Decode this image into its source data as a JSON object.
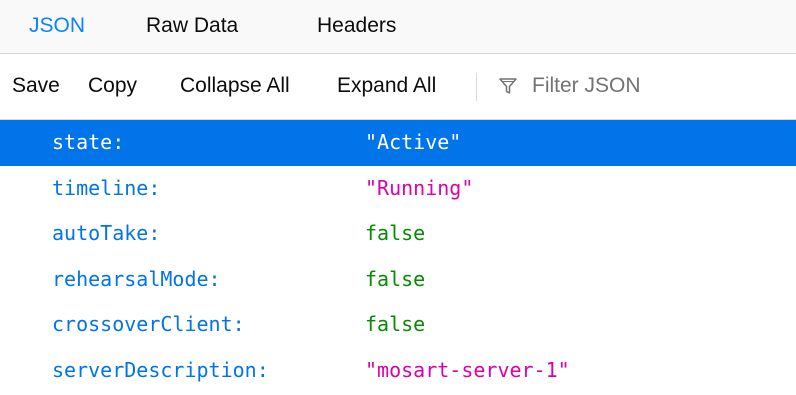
{
  "tabs": {
    "json": "JSON",
    "raw_data": "Raw Data",
    "headers": "Headers",
    "selected": "JSON"
  },
  "toolbar": {
    "save": "Save",
    "copy": "Copy",
    "collapse_all": "Collapse All",
    "expand_all": "Expand All",
    "filter_icon": "filter-icon",
    "filter_placeholder": "Filter JSON"
  },
  "colors": {
    "accent": "#0a84ff",
    "selected_row": "#0074e8",
    "key": "#0074e8",
    "string_value": "#dd00a9",
    "boolean_value": "#058b00"
  },
  "rows": [
    {
      "key": "state:",
      "value": "\"Active\"",
      "type": "string",
      "selected": true
    },
    {
      "key": "timeline:",
      "value": "\"Running\"",
      "type": "string",
      "selected": false
    },
    {
      "key": "autoTake:",
      "value": "false",
      "type": "boolean",
      "selected": false
    },
    {
      "key": "rehearsalMode:",
      "value": "false",
      "type": "boolean",
      "selected": false
    },
    {
      "key": "crossoverClient:",
      "value": "false",
      "type": "boolean",
      "selected": false
    },
    {
      "key": "serverDescription:",
      "value": "\"mosart-server-1\"",
      "type": "string",
      "selected": false
    }
  ]
}
